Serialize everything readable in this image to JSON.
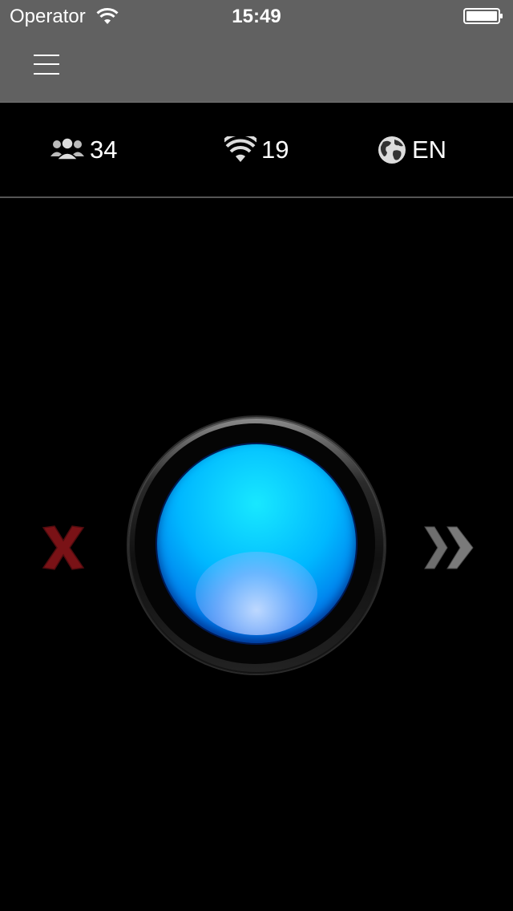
{
  "status_bar": {
    "carrier": "Operator",
    "time": "15:49"
  },
  "stats": {
    "users_count": "34",
    "signal_count": "19",
    "language": "EN"
  },
  "icons": {
    "menu": "hamburger-menu-icon",
    "users": "users-group-icon",
    "signal": "wifi-icon",
    "language": "globe-icon",
    "cancel": "close-icon",
    "forward": "double-chevron-right-icon"
  },
  "colors": {
    "header_bg": "#616161",
    "background": "#000000",
    "cancel": "#7a1216",
    "forward": "#6e6e6e",
    "button_blue": "#00b8ff"
  }
}
